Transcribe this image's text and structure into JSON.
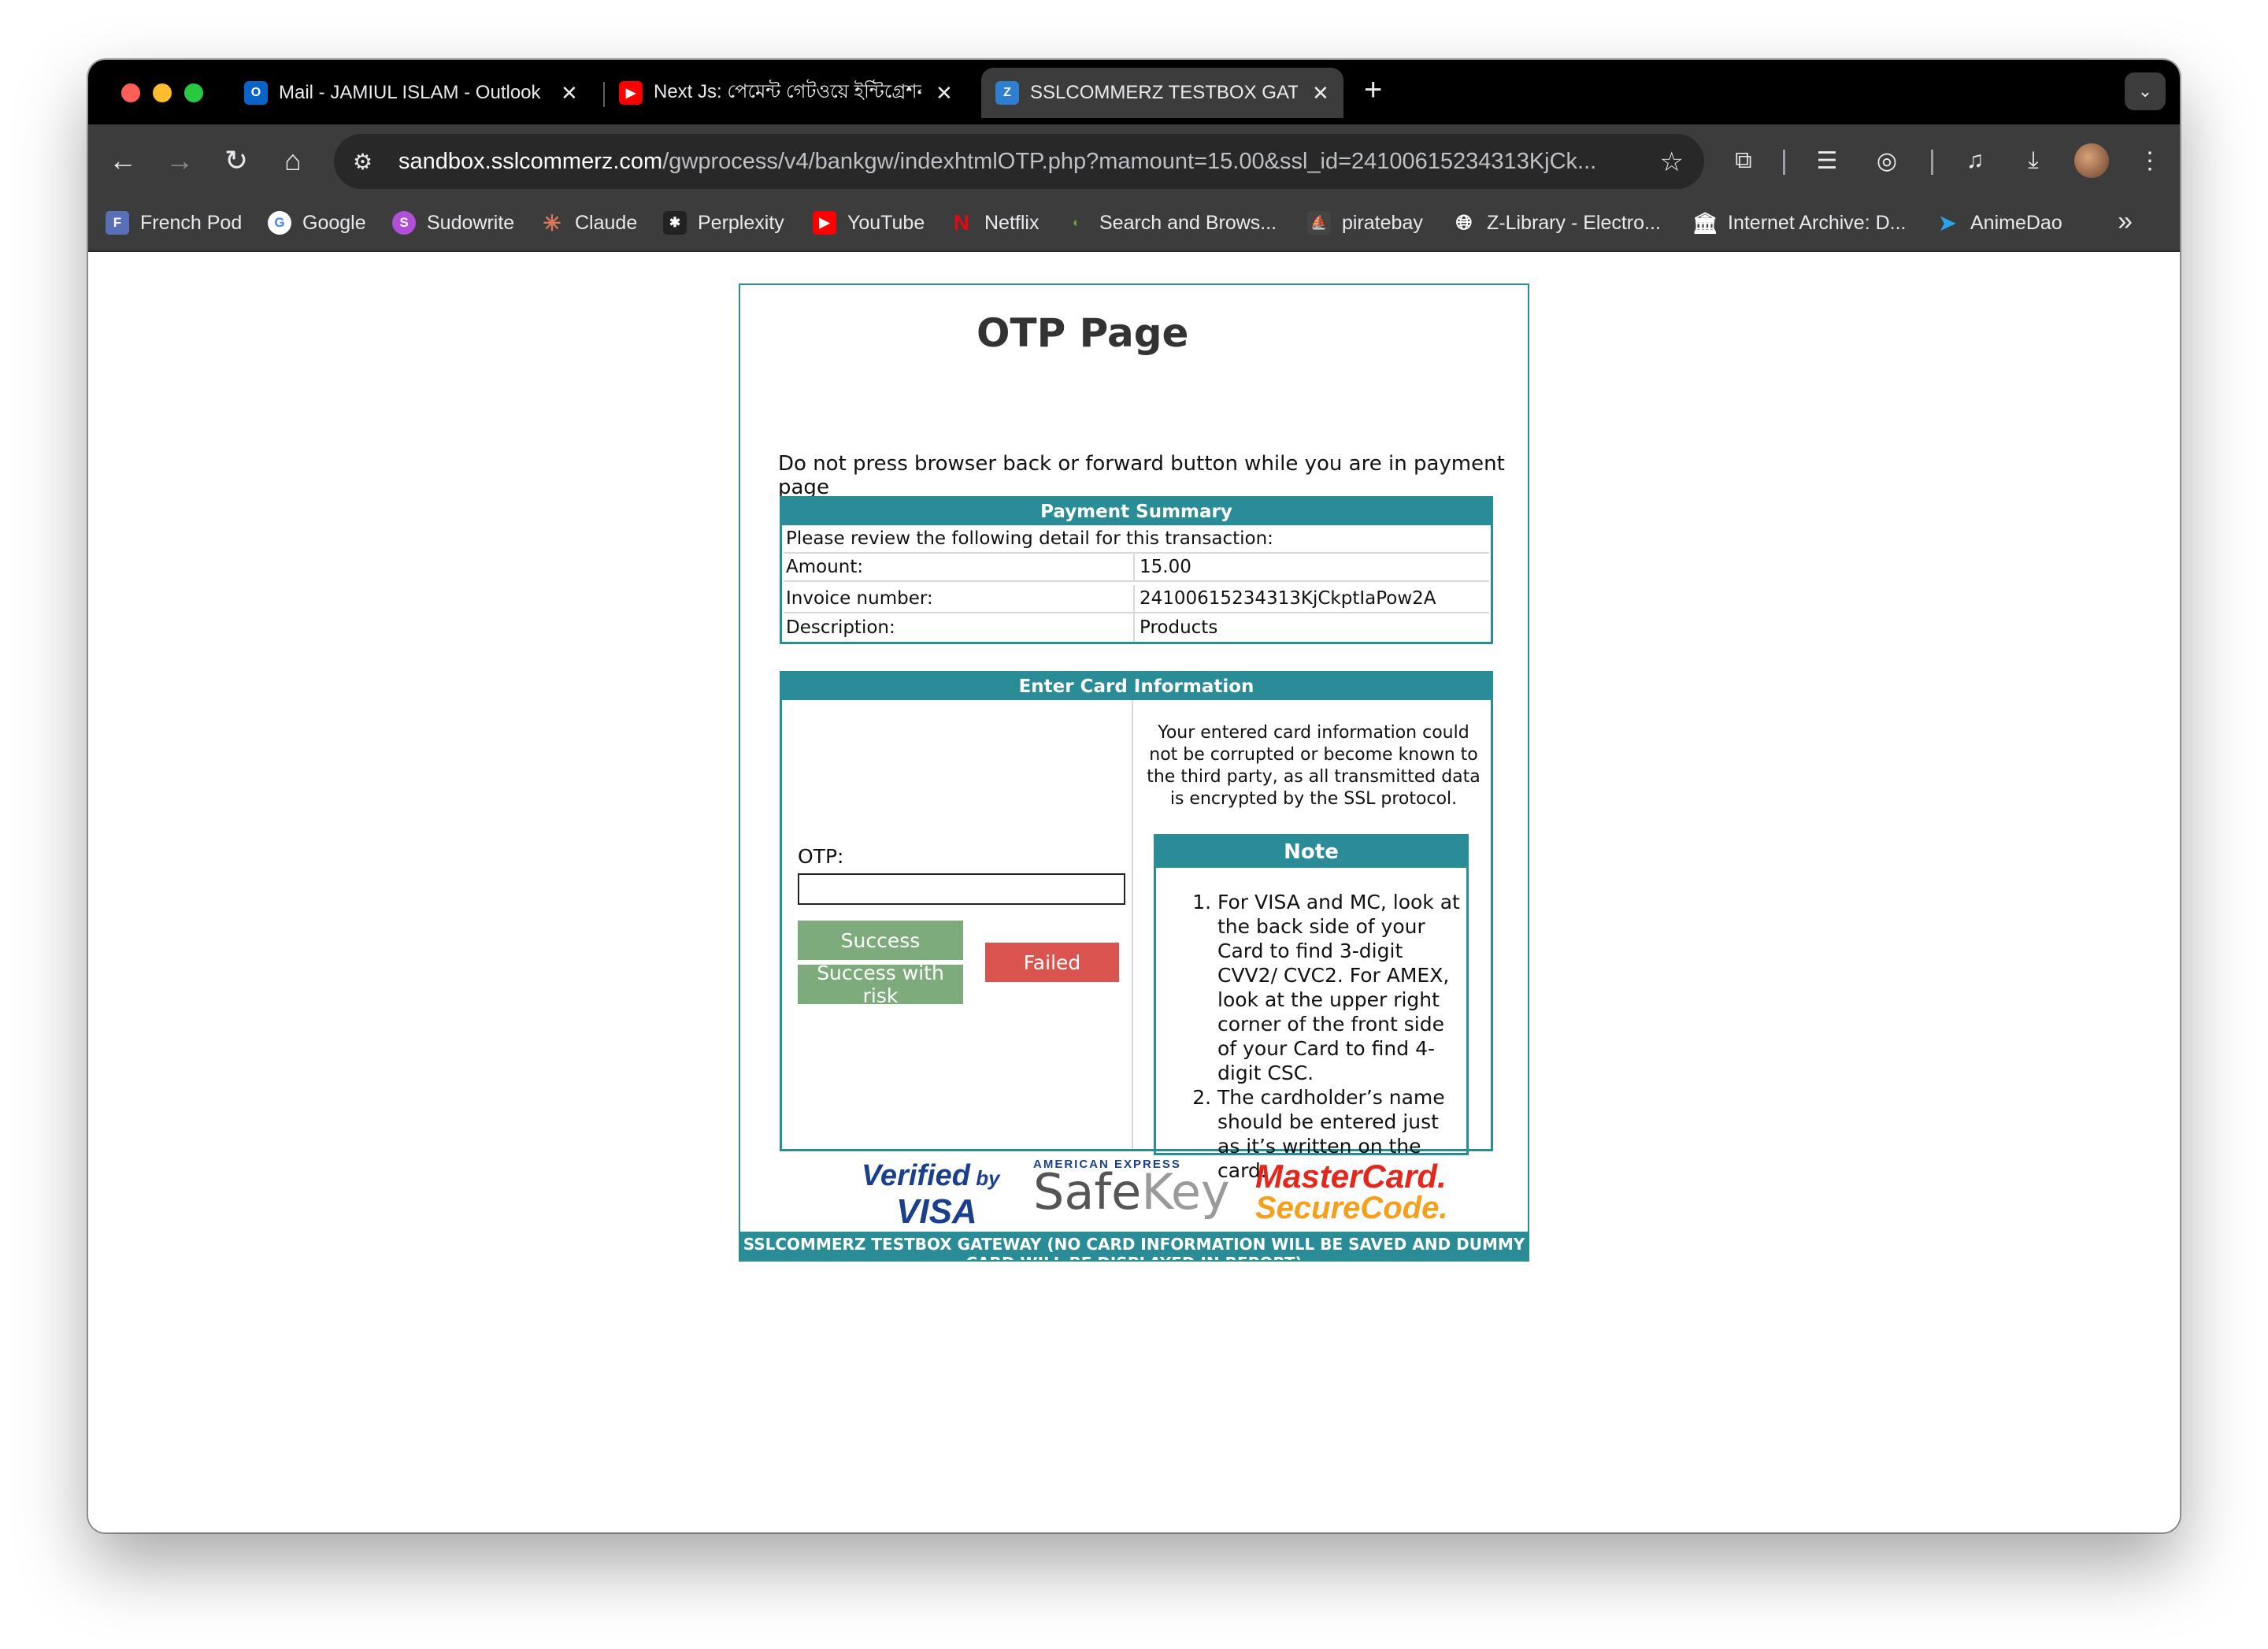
{
  "browser": {
    "tabs": [
      {
        "title": "Mail - JAMIUL ISLAM - Outlook",
        "favicon": "outlook-icon"
      },
      {
        "title": "Next Js: পেমেন্ট গেটওয়ে ইন্টিগ্রেশন",
        "favicon": "youtube-icon"
      },
      {
        "title": "SSLCOMMERZ TESTBOX GATEWAY",
        "favicon": "sslcommerz-icon",
        "active": true
      }
    ],
    "url_host": "sandbox.sslcommerz.com",
    "url_path": "/gwprocess/v4/bankgw/indexhtmlOTP.php?mamount=15.00&ssl_id=24100615234313KjCk...",
    "bookmarks": [
      {
        "label": "French Pod",
        "icon": "frenchpod-icon"
      },
      {
        "label": "Google",
        "icon": "google-icon"
      },
      {
        "label": "Sudowrite",
        "icon": "sudowrite-icon"
      },
      {
        "label": "Claude",
        "icon": "claude-icon"
      },
      {
        "label": "Perplexity",
        "icon": "perplexity-icon"
      },
      {
        "label": "YouTube",
        "icon": "youtube-icon"
      },
      {
        "label": "Netflix",
        "icon": "netflix-icon"
      },
      {
        "label": "Search and Brows...",
        "icon": "search-browse-icon"
      },
      {
        "label": "piratebay",
        "icon": "piratebay-icon"
      },
      {
        "label": "Z-Library - Electro...",
        "icon": "globe-icon"
      },
      {
        "label": "Internet Archive: D...",
        "icon": "archive-icon"
      },
      {
        "label": "AnimeDao",
        "icon": "animedao-icon"
      }
    ],
    "more_glyph": "»"
  },
  "page": {
    "title": "OTP Page",
    "warning": "Do not press browser back or forward button while you are in payment page",
    "summary": {
      "heading": "Payment Summary",
      "intro": "Please review the following detail for this transaction:",
      "rows": [
        {
          "label": "Amount:",
          "value": "15.00"
        },
        {
          "label": "Invoice number:",
          "value": "24100615234313KjCkptIaPow2A"
        },
        {
          "label": "Description:",
          "value": "Products"
        }
      ]
    },
    "card": {
      "heading": "Enter Card Information",
      "otp_label": "OTP:",
      "otp_value": "",
      "buttons": {
        "success": "Success",
        "success_risk": "Success with risk",
        "failed": "Failed"
      },
      "secure_text": "Your entered card information could not be corrupted or become known to the third party, as all transmitted data is encrypted by the SSL protocol.",
      "note_heading": "Note",
      "notes": [
        "For VISA and MC, look at the back side of your Card to find 3-digit CVV2/ CVC2. For AMEX, look at the upper right corner of the front side of your Card to find 4-digit CSC.",
        "The cardholder’s name should be entered just as it’s written on the card."
      ]
    },
    "logos": {
      "vbv_line1": "Verified",
      "vbv_by": "by",
      "vbv_line2": "VISA",
      "amex": "AMERICAN EXPRESS",
      "safe": "Safe",
      "key": "Key",
      "mc_line1": "MasterCard.",
      "mc_line2": "SecureCode."
    },
    "footer": "SSLCOMMERZ TESTBOX GATEWAY (NO CARD INFORMATION WILL BE SAVED AND DUMMY CARD WILL BE DISPLAYED IN REPORT)"
  },
  "colors": {
    "accent": "#2a8c96",
    "success": "#7dab7b",
    "failed": "#d9534f"
  }
}
